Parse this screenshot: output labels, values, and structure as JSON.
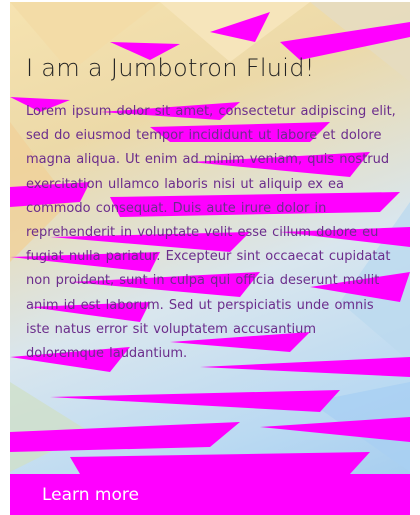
{
  "jumbotron": {
    "title": "I am a Jumbotron Fluid!",
    "lead": "Lorem ipsum dolor sit amet, consectetur adipiscing elit, sed do eiusmod tempor incididunt ut labore et dolore magna aliqua. Ut enim ad minim veniam, quis nostrud exercitation ullamco laboris nisi ut aliquip ex ea commodo consequat. Duis aute irure dolor in reprehenderit in voluptate velit esse cillum dolore eu fugiat nulla pariatur. Excepteur sint occaecat cupidatat non proident, sunt in culpa qui officia deserunt mollit anim id est laborum. Sed ut perspiciatis unde omnis iste natus error sit voluptatem accusantium doloremque laudantium.",
    "button_label": "Learn more"
  },
  "colors": {
    "accent": "#ff00ff",
    "title_text": "#232323",
    "lead_text": "#6b2d8c"
  }
}
